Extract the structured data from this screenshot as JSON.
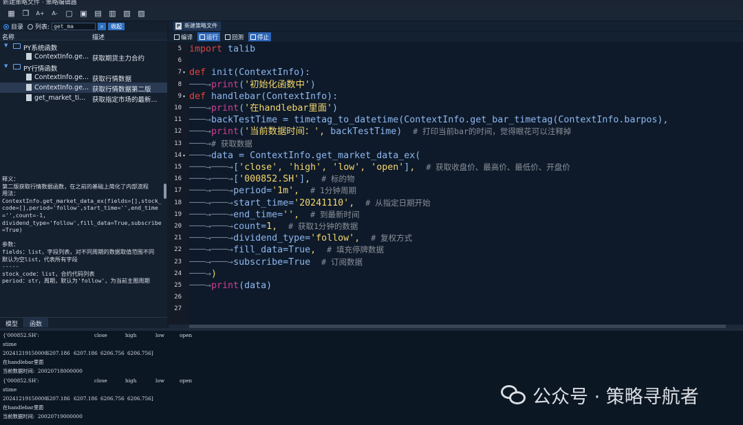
{
  "window": {
    "title": "新建策略文件 · 策略编辑器"
  },
  "toolbar": {
    "buttons": [
      {
        "name": "grid-icon",
        "glyph": "▦"
      },
      {
        "name": "copy-icon",
        "glyph": "❐"
      },
      {
        "name": "font-increase-icon",
        "glyph": "A+"
      },
      {
        "name": "font-decrease-icon",
        "glyph": "A-"
      },
      {
        "name": "new-file-icon",
        "glyph": "▢"
      },
      {
        "name": "save-file-icon",
        "glyph": "▣"
      },
      {
        "name": "document-icon",
        "glyph": "▤"
      },
      {
        "name": "document-list-icon",
        "glyph": "▥"
      },
      {
        "name": "settings-doc-icon",
        "glyph": "▧"
      },
      {
        "name": "import-icon",
        "glyph": "▨"
      }
    ]
  },
  "filter": {
    "dir_label": "目录",
    "list_label": "列表:",
    "search_value": "get_ma",
    "collapse_label": "收起"
  },
  "tree": {
    "col_name": "名称",
    "col_desc": "描述",
    "nodes": [
      {
        "type": "folder",
        "label": "PY系统函数",
        "desc": ""
      },
      {
        "type": "file",
        "label": "ContextInfo.ge...",
        "desc": "获取期货主力合约"
      },
      {
        "type": "folder",
        "label": "PY行情函数",
        "desc": ""
      },
      {
        "type": "file",
        "label": "ContextInfo.ge...",
        "desc": "获取行情数据"
      },
      {
        "type": "file",
        "label": "ContextInfo.ge...",
        "desc": "获取行情数据第二版"
      },
      {
        "type": "file",
        "label": "get_market_ti...",
        "desc": "获取指定市场的最新..."
      }
    ]
  },
  "help": {
    "text": "释义：\n第二版获取行情数据函数，在之前的基础上简化了内部流程\n用法：\nContextInfo.get_market_data_ex(fields=[],stock_code=[],period='follow',start_time='',end_time='',count=-1,\ndividend_type='follow',fill_data=True,subscribe=True)\n\n参数：\nfields：list，字段列表，对不同周期的数据取值范围不同\n默认为空list，代表所有字段\n-----\nstock_code：list，合约代码列表\nperiod：str，周期，默认为'follow'，为当前主图周期"
  },
  "bottom_tabs": [
    "模型",
    "函数"
  ],
  "editor": {
    "file_tab": "新建策略文件",
    "file_tab_icon": "P",
    "actions": [
      {
        "name": "compile-button",
        "label": "编译",
        "active": false
      },
      {
        "name": "run-button",
        "label": "运行",
        "active": true
      },
      {
        "name": "backtest-button",
        "label": "回测",
        "active": false
      },
      {
        "name": "stop-button",
        "label": "停止",
        "active": true
      }
    ],
    "lines": [
      {
        "no": "5",
        "fold": "",
        "tabs": 0,
        "segs": [
          [
            "kw",
            "import"
          ],
          [
            "fn",
            " talib"
          ]
        ]
      },
      {
        "no": "6",
        "fold": "",
        "tabs": 0,
        "segs": []
      },
      {
        "no": "7",
        "fold": "▾",
        "tabs": 0,
        "segs": [
          [
            "kw",
            "def"
          ],
          [
            "fn",
            " init(ContextInfo):"
          ]
        ]
      },
      {
        "no": "8",
        "fold": "",
        "tabs": 1,
        "segs": [
          [
            "bi",
            "print"
          ],
          [
            "fn",
            "("
          ],
          [
            "str",
            "'初始化函数中'"
          ],
          [
            "fn",
            ")"
          ]
        ]
      },
      {
        "no": "9",
        "fold": "▾",
        "tabs": 0,
        "segs": [
          [
            "kw",
            "def"
          ],
          [
            "fn",
            " handlebar(ContextInfo):"
          ]
        ]
      },
      {
        "no": "10",
        "fold": "",
        "tabs": 1,
        "segs": [
          [
            "bi",
            "print"
          ],
          [
            "fn",
            "("
          ],
          [
            "str",
            "'在handlebar里面'"
          ],
          [
            "fn",
            ")"
          ]
        ]
      },
      {
        "no": "11",
        "fold": "",
        "tabs": 1,
        "segs": [
          [
            "fn",
            "backTestTime = timetag_to_datetime(ContextInfo.get_bar_timetag(ContextInfo.barpos),"
          ]
        ]
      },
      {
        "no": "12",
        "fold": "",
        "tabs": 1,
        "segs": [
          [
            "bi",
            "print"
          ],
          [
            "fn",
            "("
          ],
          [
            "str",
            "'当前数据时间：'"
          ],
          [
            "pun",
            ", "
          ],
          [
            "fn",
            "backTestTime)  "
          ],
          [
            "cmt",
            "# 打印当前bar的时间，觉得眼花可以注释掉"
          ]
        ]
      },
      {
        "no": "13",
        "fold": "",
        "tabs": 1,
        "segs": [
          [
            "cmt",
            "# 获取数据"
          ]
        ]
      },
      {
        "no": "14",
        "fold": "▾",
        "tabs": 1,
        "segs": [
          [
            "fn",
            "data = ContextInfo.get_market_data_ex("
          ]
        ]
      },
      {
        "no": "15",
        "fold": "",
        "tabs": 2,
        "segs": [
          [
            "fn",
            "["
          ],
          [
            "str",
            "'close'"
          ],
          [
            "pun",
            ", "
          ],
          [
            "str",
            "'high'"
          ],
          [
            "pun",
            ", "
          ],
          [
            "str",
            "'low'"
          ],
          [
            "pun",
            ", "
          ],
          [
            "str",
            "'open'"
          ],
          [
            "fn",
            "]"
          ],
          [
            "pun",
            ",  "
          ],
          [
            "cmt",
            "# 获取收盘价、最高价、最低价、开盘价"
          ]
        ]
      },
      {
        "no": "16",
        "fold": "",
        "tabs": 2,
        "segs": [
          [
            "fn",
            "["
          ],
          [
            "str",
            "'000852.SH'"
          ],
          [
            "fn",
            "]"
          ],
          [
            "pun",
            ",  "
          ],
          [
            "cmt",
            "# 标的物"
          ]
        ]
      },
      {
        "no": "17",
        "fold": "",
        "tabs": 2,
        "segs": [
          [
            "fn",
            "period="
          ],
          [
            "str",
            "'1m'"
          ],
          [
            "pun",
            ",  "
          ],
          [
            "cmt",
            "# 1分钟周期"
          ]
        ]
      },
      {
        "no": "18",
        "fold": "",
        "tabs": 2,
        "segs": [
          [
            "fn",
            "start_time="
          ],
          [
            "str",
            "'20241110'"
          ],
          [
            "pun",
            ",  "
          ],
          [
            "cmt",
            "# 从指定日期开始"
          ]
        ]
      },
      {
        "no": "19",
        "fold": "",
        "tabs": 2,
        "segs": [
          [
            "fn",
            "end_time="
          ],
          [
            "str",
            "''"
          ],
          [
            "pun",
            ",  "
          ],
          [
            "cmt",
            "# 到最新时间"
          ]
        ]
      },
      {
        "no": "20",
        "fold": "",
        "tabs": 2,
        "segs": [
          [
            "fn",
            "count="
          ],
          [
            "num",
            "1"
          ],
          [
            "pun",
            ",  "
          ],
          [
            "cmt",
            "# 获取1分钟的数据"
          ]
        ]
      },
      {
        "no": "21",
        "fold": "",
        "tabs": 2,
        "segs": [
          [
            "fn",
            "dividend_type="
          ],
          [
            "str",
            "'follow'"
          ],
          [
            "pun",
            ",  "
          ],
          [
            "cmt",
            "# 复权方式"
          ]
        ]
      },
      {
        "no": "22",
        "fold": "",
        "tabs": 2,
        "segs": [
          [
            "fn",
            "fill_data=True"
          ],
          [
            "pun",
            ",  "
          ],
          [
            "cmt",
            "# 填充停牌数据"
          ]
        ]
      },
      {
        "no": "23",
        "fold": "",
        "tabs": 2,
        "segs": [
          [
            "fn",
            "subscribe=True  "
          ],
          [
            "cmt",
            "# 订阅数据"
          ]
        ]
      },
      {
        "no": "24",
        "fold": "",
        "tabs": 1,
        "segs": [
          [
            "pun",
            ")"
          ]
        ]
      },
      {
        "no": "25",
        "fold": "",
        "tabs": 1,
        "segs": [
          [
            "bi",
            "print"
          ],
          [
            "fn",
            "(data)"
          ]
        ]
      },
      {
        "no": "26",
        "fold": "",
        "tabs": 0,
        "segs": []
      },
      {
        "no": "27",
        "fold": "",
        "tabs": 0,
        "segs": []
      }
    ]
  },
  "console": {
    "blocks": [
      {
        "dict_head": "{'000852.SH':",
        "cols": [
          "close",
          "high",
          "low",
          "open"
        ],
        "stime": "stime",
        "row_time": "20241219150000",
        "row_vals": [
          "6207.186",
          "6207.186",
          "6206.756",
          "6206.756]"
        ],
        "msg1": "在handlebar里面",
        "msg2": "当前数据时间:  20020718000000"
      },
      {
        "dict_head": "{'000852.SH':",
        "cols": [
          "close",
          "high",
          "low",
          "open"
        ],
        "stime": "stime",
        "row_time": "20241219150000",
        "row_vals": [
          "6207.186",
          "6207.186",
          "6206.756",
          "6206.756]"
        ],
        "msg1": "在handlebar里面",
        "msg2": "当前数据时间:  20020719000000"
      }
    ]
  },
  "watermark": {
    "text": "公众号 · 策略寻航者"
  }
}
